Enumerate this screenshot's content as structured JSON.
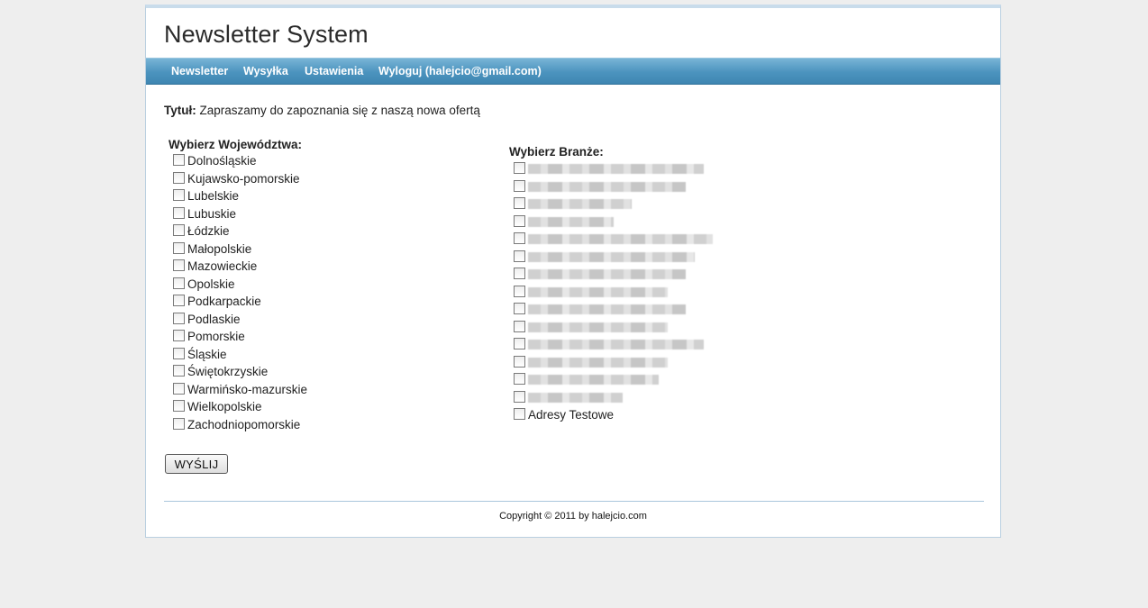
{
  "header": {
    "title": "Newsletter System"
  },
  "nav": [
    {
      "label": "Newsletter"
    },
    {
      "label": "Wysyłka"
    },
    {
      "label": "Ustawienia"
    },
    {
      "label": "Wyloguj (halejcio@gmail.com)"
    }
  ],
  "message": {
    "title_label": "Tytuł:",
    "title_value": "Zapraszamy do zapoznania się z naszą nowa ofertą"
  },
  "voivodeships": {
    "heading": "Wybierz Województwa:",
    "items": [
      "Dolnośląskie",
      "Kujawsko-pomorskie",
      "Lubelskie",
      "Lubuskie",
      "Łódzkie",
      "Małopolskie",
      "Mazowieckie",
      "Opolskie",
      "Podkarpackie",
      "Podlaskie",
      "Pomorskie",
      "Śląskie",
      "Świętokrzyskie",
      "Warmińsko-mazurskie",
      "Wielkopolskie",
      "Zachodniopomorskie"
    ]
  },
  "industries": {
    "heading": "Wybierz Branże:",
    "last_item": "Adresy Testowe"
  },
  "actions": {
    "send_label": "WYŚLIJ"
  },
  "footer": {
    "copyright": "Copyright © 2011 by halejcio.com"
  }
}
